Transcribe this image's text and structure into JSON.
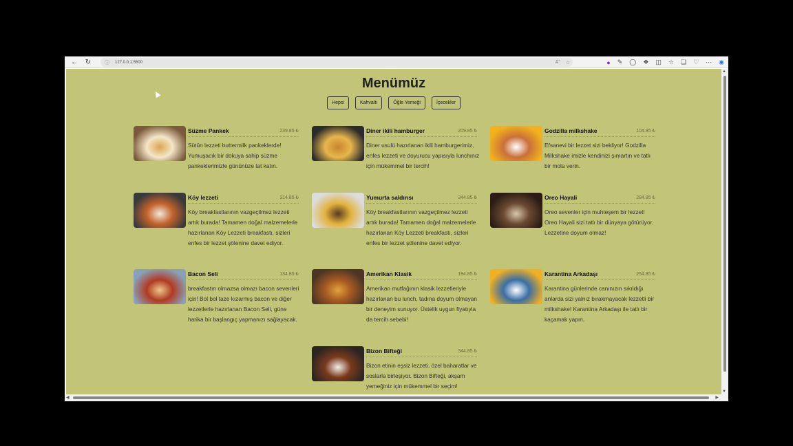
{
  "browser": {
    "url": "127.0.0.1:5500",
    "back_icon": "back-arrow-icon",
    "refresh_icon": "refresh-icon",
    "info_icon": "info-icon"
  },
  "page": {
    "title": "Menümüz",
    "filters": [
      "Hepsi",
      "Kahvaltı",
      "Öğle Yemeği",
      "İçecekler"
    ],
    "items": [
      {
        "name": "Süzme Pankek",
        "price": "239.85 ₺",
        "desc": "Sütün lezzeti buttermilk pankeklerde! Yumuşacık bir dokuya sahip süzme pankeklerimizle gününüze tat katın.",
        "colors": [
          "#7a5a3a",
          "#d9a54e",
          "#f5e6c8"
        ]
      },
      {
        "name": "Diner ikili hamburger",
        "price": "209.85 ₺",
        "desc": "Diner usulü hazırlanan ikili hamburgerimiz, enfes lezzeti ve doyurucu yapısıyla lunchınız için mükemmel bir tercih!",
        "colors": [
          "#2b2b2b",
          "#c8842e",
          "#e8b64c"
        ]
      },
      {
        "name": "Godzilla milkshake",
        "price": "104.85 ₺",
        "desc": "Efsanevi bir lezzet sizi bekliyor! Godzilla Milkshake imizle kendinizi şımartın ve tatlı bir mola verin.",
        "colors": [
          "#f3b21d",
          "#ffffff",
          "#c9703a"
        ]
      },
      {
        "name": "Köy lezzeti",
        "price": "314.85 ₺",
        "desc": "Köy breakfastlarının vazgeçilmez lezzeti artık burada! Tamamen doğal malzemelerle hazırlanan Köy Lezzeti breakfastı, sizleri enfes bir lezzet şölenine davet ediyor.",
        "colors": [
          "#3a3a3a",
          "#f0e9dc",
          "#c5632c"
        ]
      },
      {
        "name": "Yumurta saldırısı",
        "price": "344.85 ₺",
        "desc": "Köy breakfastlarının vazgeçilmez lezzeti artık burada! Tamamen doğal malzemelerle hazırlanan Köy Lezzeti breakfastı, sizleri enfes bir lezzet şölenine davet ediyor.",
        "colors": [
          "#dcdcdc",
          "#5a3a22",
          "#e3b23c"
        ]
      },
      {
        "name": "Oreo Hayali",
        "price": "284.85 ₺",
        "desc": "Oreo sevenler için muhteşem bir lezzet! Oreo Hayali sizi tatlı bir dünyaya götürüyor. Lezzetine doyum olmaz!",
        "colors": [
          "#2a1c14",
          "#d9c7ae",
          "#6b4a32"
        ]
      },
      {
        "name": "Bacon Seli",
        "price": "134.85 ₺",
        "desc": "breakfastın olmazsa olmazı bacon sevenleri için! Bol bol taze kızarmış bacon ve diğer lezzetlerle hazırlanan Bacon Seli, güne harika bir başlangıç yapmanızı sağlayacak.",
        "colors": [
          "#8aa0b8",
          "#e9c98a",
          "#b23a22"
        ]
      },
      {
        "name": "Amerikan Klasik",
        "price": "194.85 ₺",
        "desc": "Amerikan mutfağının klasik lezzetleriyle hazırlanan bu lunch, tadına doyum olmayan bir deneyim sunuyor. Üstelik uygun fiyatıyla da tercih sebebi!",
        "colors": [
          "#4a3526",
          "#e2a23a",
          "#a65a22"
        ]
      },
      {
        "name": "Karantina Arkadaşı",
        "price": "254.85 ₺",
        "desc": "Karantina günlerinde canınızın sıkıldığı anlarda sizi yalnız bırakmayacak lezzetli bir milkshake! Karantina Arkadaşı ile tatlı bir kaçamak yapın.",
        "colors": [
          "#f0b024",
          "#ffffff",
          "#3a6ea5"
        ]
      },
      {
        "name": "Bizon Bifteği",
        "price": "344.85 ₺",
        "desc": "Bizon etinin eşsiz lezzeti, özel baharatlar ve soslarla birleşiyor. Bizon Bifteği, akşam yemeğiniz için mükemmel bir seçim!",
        "colors": [
          "#2b2522",
          "#f2f0ea",
          "#7a3a1c"
        ]
      }
    ]
  }
}
